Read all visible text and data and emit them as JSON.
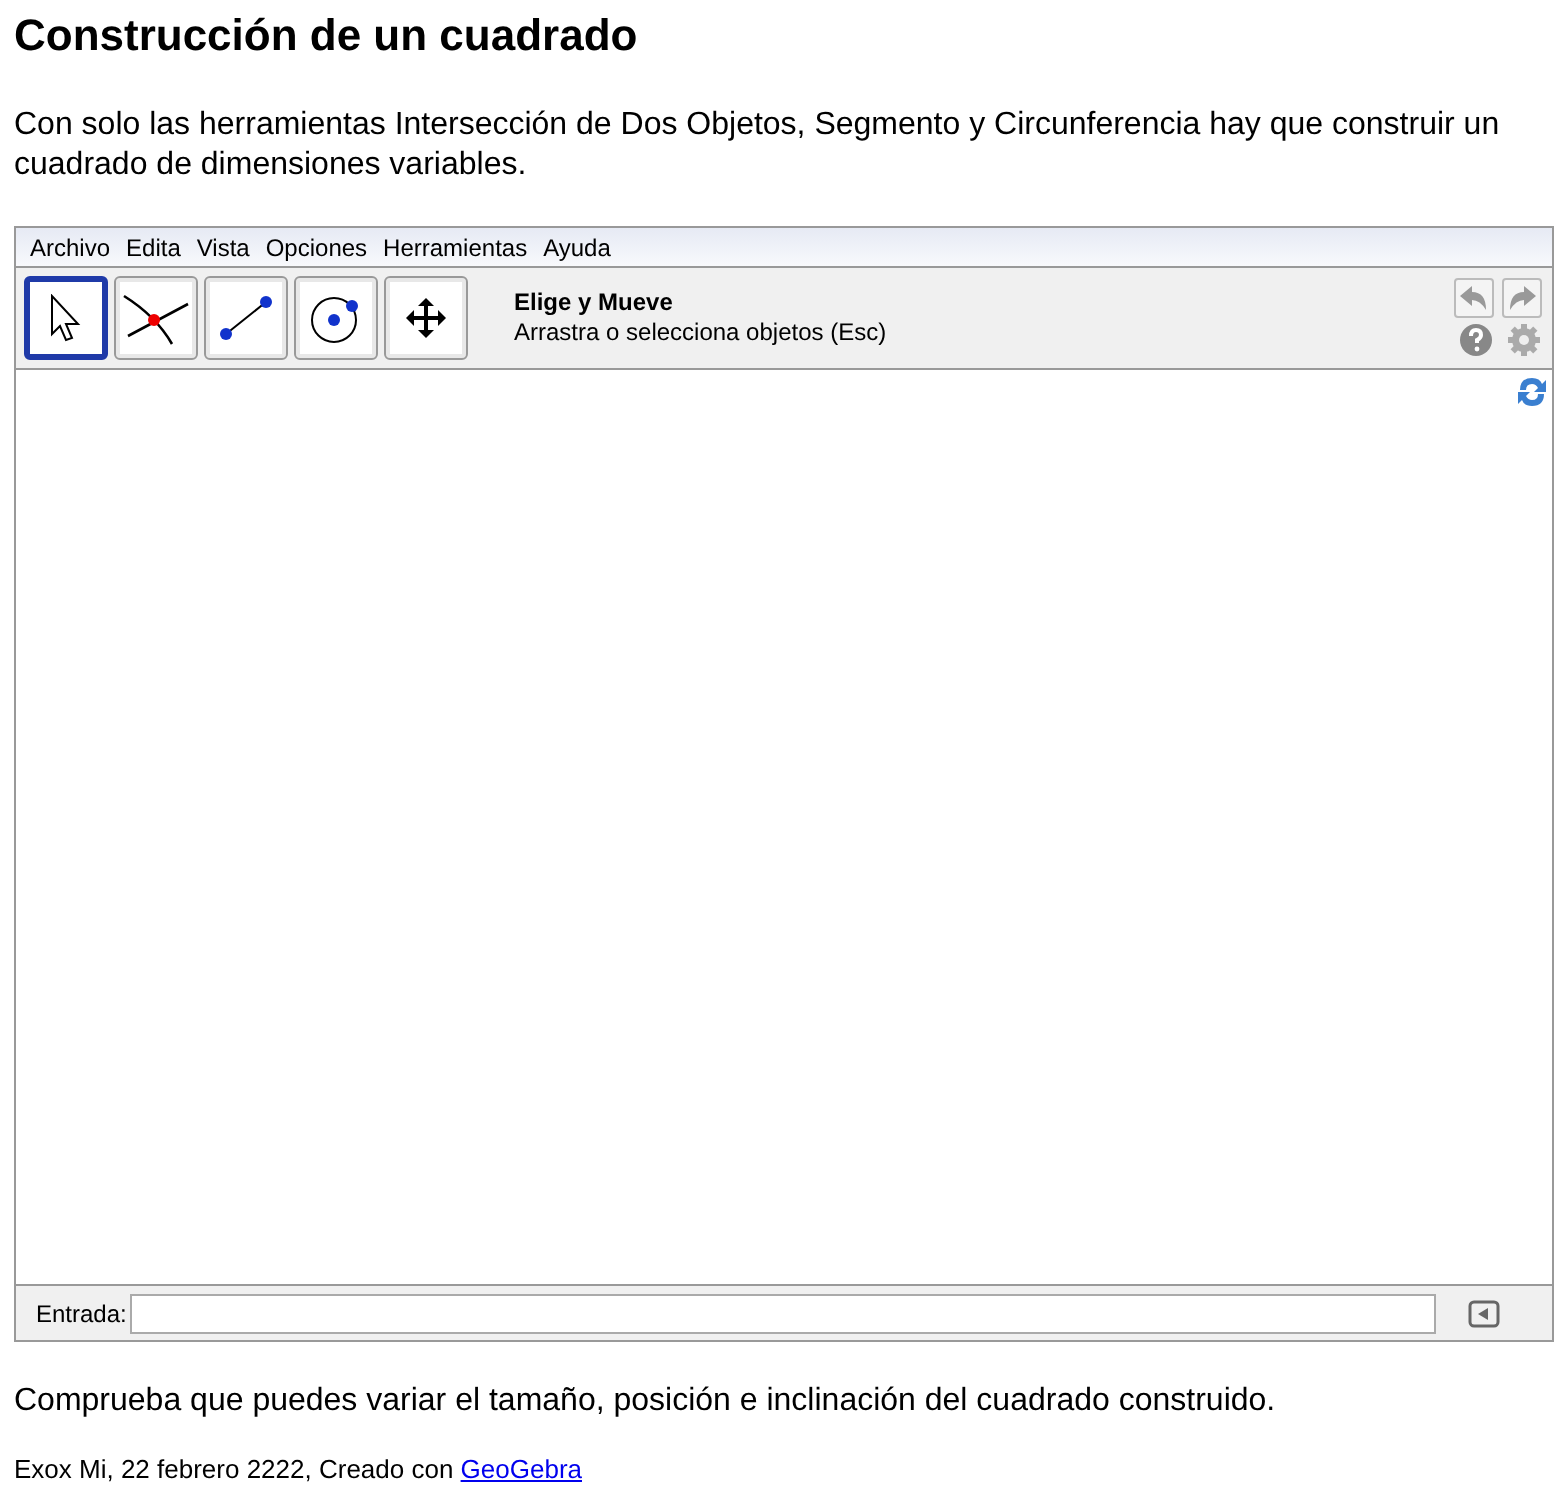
{
  "title": "Construcción de un cuadrado",
  "intro": "Con solo las herramientas Intersección de Dos Objetos, Segmento y Circunferencia hay que construir un cuadrado de dimensiones variables.",
  "applet": {
    "menu": [
      "Archivo",
      "Edita",
      "Vista",
      "Opciones",
      "Herramientas",
      "Ayuda"
    ],
    "tools": [
      {
        "kind": "move",
        "selected": true
      },
      {
        "kind": "intersect",
        "selected": false
      },
      {
        "kind": "segment",
        "selected": false
      },
      {
        "kind": "circle",
        "selected": false
      },
      {
        "kind": "pan",
        "selected": false
      }
    ],
    "tool_name": "Elige y Mueve",
    "tool_help": "Arrastra o selecciona objetos (Esc)",
    "input_label": "Entrada:"
  },
  "outro": "Comprueba que puedes variar el tamaño, posición e inclinación del cuadrado construido.",
  "footer": {
    "text": "Exox Mi, 22 febrero 2222, Creado con ",
    "link": "GeoGebra"
  }
}
